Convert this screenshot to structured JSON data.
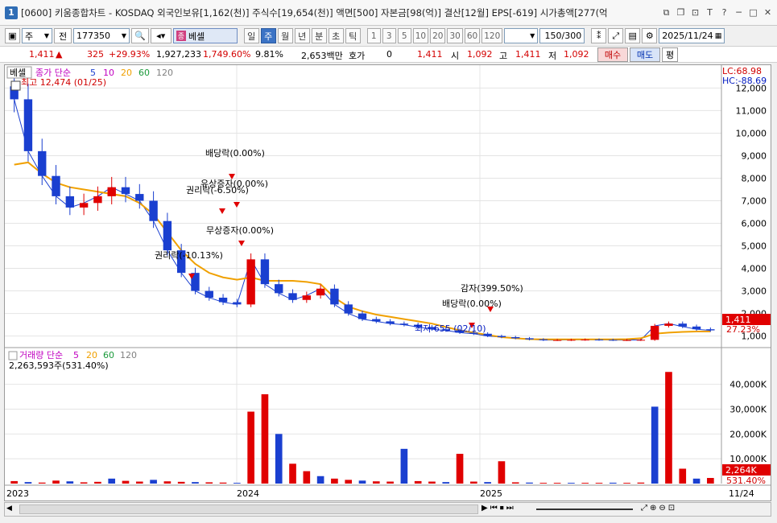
{
  "title": {
    "num": "1",
    "text": "[0600] 키움종합차트 - KOSDAQ 외국인보유[1,162(천)] 주식수[19,654(천)] 액면[500] 자본금[98(억)] 결산[12월] EPS[-619] 시가총액[277(억"
  },
  "toolbar": {
    "period_unit": "주",
    "adj": "전",
    "code": "177350",
    "name": "베셀",
    "periods": [
      "일",
      "주",
      "월",
      "년",
      "분",
      "초",
      "틱"
    ],
    "active_period": "주",
    "ticks": [
      "1",
      "3",
      "5",
      "10",
      "20",
      "30",
      "60",
      "120"
    ],
    "count": "150",
    "count_total": "/300",
    "date": "2025/11/24"
  },
  "quote": {
    "price": "1,411",
    "change": "325",
    "change_pct": "+29.93%",
    "volume": "1,927,233",
    "volume_pct": "1,749.60%",
    "turnover": "9.81%",
    "amount": "2,653백만",
    "hoga_label": "호가",
    "hoga": "0",
    "hoga_price": "1,411",
    "open_label": "시",
    "open": "1,092",
    "high_label": "고",
    "high": "1,411",
    "low_label": "저",
    "low": "1,092",
    "buy_label": "매수",
    "sell_label": "매도",
    "eval_label": "평"
  },
  "price_panel": {
    "name": "베셀",
    "legend_title": "종가 단순",
    "legend": [
      {
        "label": "5",
        "color": "#1a3fd0"
      },
      {
        "label": "10",
        "color": "#c000c0"
      },
      {
        "label": "20",
        "color": "#f0a000"
      },
      {
        "label": "60",
        "color": "#1a9a3a"
      },
      {
        "label": "120",
        "color": "#808080"
      }
    ],
    "high_note": "최고 12,474 (01/25)",
    "low_note": "최저 655 (02/10)",
    "lc": "LC:68.98",
    "hc": "HC:-88.69",
    "last_price": "1,411",
    "last_pct": "27.23%",
    "annotations": [
      "배당락(0.00%)",
      "유상증자(0.00%)",
      "권리락(-6.50%)",
      "무상증자(0.00%)",
      "권리락(-10.13%)",
      "감자(399.50%)",
      "배당락(0.00%)"
    ]
  },
  "volume_panel": {
    "legend_title": "거래량 단순",
    "legend": [
      {
        "label": "5",
        "color": "#c000c0"
      },
      {
        "label": "20",
        "color": "#f0a000"
      },
      {
        "label": "60",
        "color": "#1a9a3a"
      },
      {
        "label": "120",
        "color": "#808080"
      }
    ],
    "value": "2,263,593주(531.40%)",
    "last_vol": "2,264K",
    "last_pct": "531.40%"
  },
  "x_axis": {
    "labels": [
      "2023",
      "2024",
      "2025"
    ],
    "last_date": "11/24"
  },
  "chart_data": [
    {
      "type": "candlestick",
      "title": "베셀",
      "y_ticks": [
        1000,
        2000,
        3000,
        4000,
        5000,
        6000,
        7000,
        8000,
        9000,
        10000,
        11000,
        12000
      ],
      "ylim": [
        700,
        12300
      ],
      "series": [
        {
          "name": "5",
          "values": [
            11500,
            9200,
            8100,
            7200,
            6700,
            6900,
            7200,
            7600,
            7300,
            7000,
            6100,
            4800,
            3800,
            3000,
            2700,
            2500,
            2400,
            4400,
            3300,
            2900,
            2600,
            2800,
            3100,
            2400,
            2000,
            1750,
            1650,
            1550,
            1500,
            1400,
            1300,
            1250,
            1150,
            1100,
            1000,
            950,
            900,
            850,
            820,
            820,
            830,
            840,
            830,
            820,
            820,
            830,
            1450,
            1550,
            1420,
            1300,
            1250
          ]
        },
        {
          "name": "20",
          "values": [
            8600,
            8700,
            8200,
            7800,
            7600,
            7500,
            7400,
            7300,
            7200,
            6900,
            6400,
            5600,
            4800,
            4200,
            3800,
            3600,
            3500,
            3600,
            3450,
            3450,
            3450,
            3400,
            3300,
            2700,
            2300,
            2100,
            1950,
            1850,
            1750,
            1650,
            1550,
            1400,
            1250,
            1150,
            1050,
            950,
            900,
            860,
            850,
            850,
            850,
            850,
            850,
            850,
            860,
            900,
            1100,
            1150,
            1180,
            1200,
            1200
          ]
        }
      ]
    },
    {
      "type": "bar",
      "title": "거래량",
      "y_ticks": [
        10000,
        20000,
        30000,
        40000
      ],
      "ylim": [
        0,
        48000
      ],
      "values": [
        1000,
        600,
        400,
        1200,
        900,
        500,
        700,
        2000,
        1100,
        800,
        1500,
        900,
        700,
        600,
        500,
        400,
        300,
        29000,
        36000,
        20000,
        8000,
        5000,
        3000,
        2000,
        1500,
        1200,
        900,
        800,
        14000,
        1000,
        800,
        600,
        12000,
        800,
        600,
        9000,
        500,
        400,
        300,
        300,
        300,
        300,
        300,
        350,
        300,
        400,
        31000,
        45000,
        6000,
        2000,
        2264
      ]
    }
  ]
}
